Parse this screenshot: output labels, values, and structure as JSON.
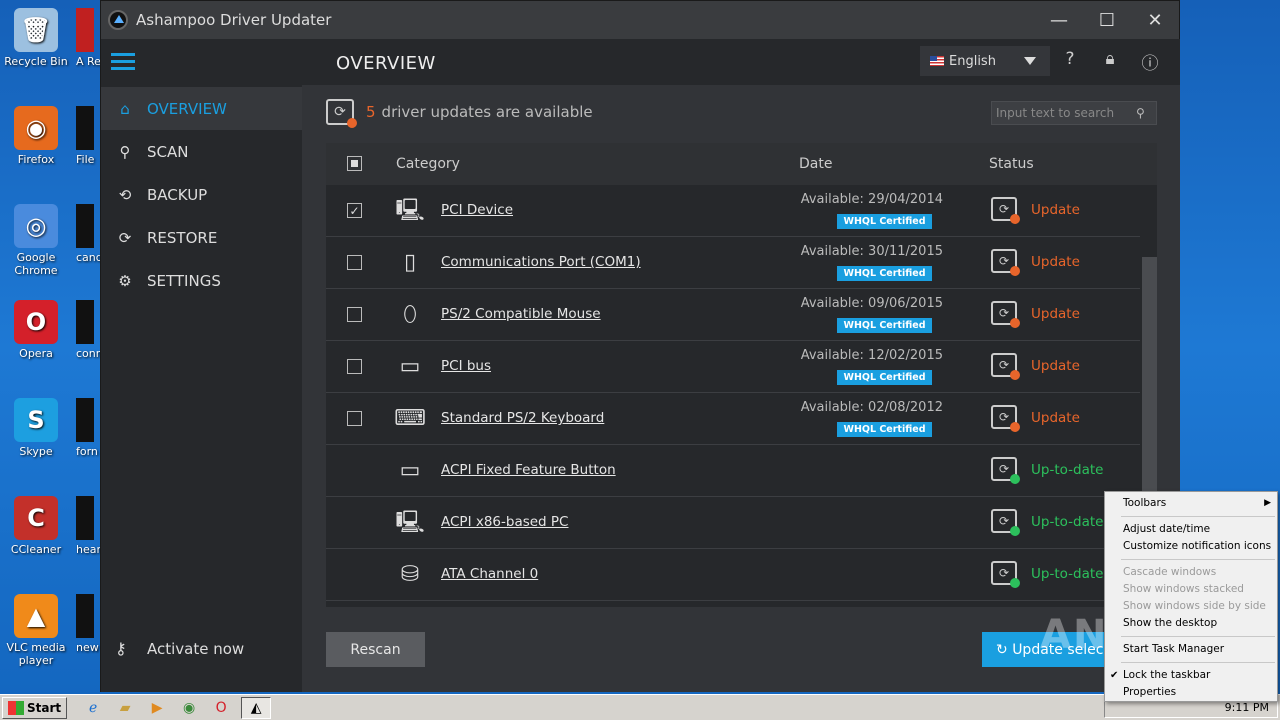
{
  "desktop": {
    "icons": [
      {
        "label": "Recycle Bin",
        "icon": "recycle-bin-icon",
        "color": "#9cc0e0"
      },
      {
        "label": "Firefox",
        "icon": "firefox-icon",
        "color": "#e66a1e"
      },
      {
        "label": "Google Chrome",
        "icon": "chrome-icon",
        "color": "#4a8bdd"
      },
      {
        "label": "Opera",
        "icon": "opera-icon",
        "color": "#d4202a"
      },
      {
        "label": "Skype",
        "icon": "skype-icon",
        "color": "#1d9fe0"
      },
      {
        "label": "CCleaner",
        "icon": "ccleaner-icon",
        "color": "#c3302a"
      },
      {
        "label": "VLC media player",
        "icon": "vlc-icon",
        "color": "#f08a1a"
      }
    ],
    "partial_icons": [
      "A Re",
      "File",
      "cand",
      "conn",
      "forn",
      "hear",
      "new"
    ]
  },
  "window": {
    "title": "Ashampoo Driver Updater",
    "page_title": "OVERVIEW",
    "language": "English",
    "nav": [
      {
        "label": "OVERVIEW",
        "icon": "home-icon",
        "active": true
      },
      {
        "label": "SCAN",
        "icon": "magnifier-icon",
        "active": false
      },
      {
        "label": "BACKUP",
        "icon": "backup-icon",
        "active": false
      },
      {
        "label": "RESTORE",
        "icon": "restore-icon",
        "active": false
      },
      {
        "label": "SETTINGS",
        "icon": "gear-icon",
        "active": false
      }
    ],
    "activate_label": "Activate now",
    "summary": {
      "count": "5",
      "text": "driver updates are available"
    },
    "search_placeholder": "Input text to search",
    "columns": {
      "category": "Category",
      "date": "Date",
      "status": "Status"
    },
    "rows": [
      {
        "name": "PCI Device",
        "icon": "pc-tower-icon",
        "glyph": "🖳",
        "checked": true,
        "has_checkbox": true,
        "date": "Available: 29/04/2014",
        "badge": "WHQL Certified",
        "status": "Update",
        "state": "update"
      },
      {
        "name": "Communications Port (COM1)",
        "icon": "usb-port-icon",
        "glyph": "▯",
        "checked": false,
        "has_checkbox": true,
        "date": "Available: 30/11/2015",
        "badge": "WHQL Certified",
        "status": "Update",
        "state": "update"
      },
      {
        "name": "PS/2 Compatible Mouse",
        "icon": "mouse-icon",
        "glyph": "⬯",
        "checked": false,
        "has_checkbox": true,
        "date": "Available: 09/06/2015",
        "badge": "WHQL Certified",
        "status": "Update",
        "state": "update"
      },
      {
        "name": "PCI bus",
        "icon": "monitor-icon",
        "glyph": "▭",
        "checked": false,
        "has_checkbox": true,
        "date": "Available: 12/02/2015",
        "badge": "WHQL Certified",
        "status": "Update",
        "state": "update"
      },
      {
        "name": "Standard PS/2 Keyboard",
        "icon": "keyboard-icon",
        "glyph": "⌨",
        "checked": false,
        "has_checkbox": true,
        "date": "Available: 02/08/2012",
        "badge": "WHQL Certified",
        "status": "Update",
        "state": "update"
      },
      {
        "name": "ACPI Fixed Feature Button",
        "icon": "monitor-icon",
        "glyph": "▭",
        "checked": false,
        "has_checkbox": false,
        "date": "",
        "badge": "",
        "status": "Up-to-date",
        "state": "ok"
      },
      {
        "name": "ACPI x86-based PC",
        "icon": "pc-tower-icon",
        "glyph": "🖳",
        "checked": false,
        "has_checkbox": false,
        "date": "",
        "badge": "",
        "status": "Up-to-date",
        "state": "ok"
      },
      {
        "name": "ATA Channel 0",
        "icon": "hard-drive-icon",
        "glyph": "⛁",
        "checked": false,
        "has_checkbox": false,
        "date": "",
        "badge": "",
        "status": "Up-to-date",
        "state": "ok"
      }
    ],
    "rescan_label": "Rescan",
    "update_selected_label": "Update selec",
    "colors": {
      "accent": "#1a9fe0",
      "update": "#e8652b",
      "ok": "#2cc05c"
    }
  },
  "context_menu": [
    {
      "label": "Toolbars",
      "disabled": false,
      "submenu": true,
      "checked": false
    },
    {
      "sep": true
    },
    {
      "label": "Adjust date/time",
      "disabled": false,
      "submenu": false,
      "checked": false
    },
    {
      "label": "Customize notification icons",
      "disabled": false,
      "submenu": false,
      "checked": false
    },
    {
      "sep": true
    },
    {
      "label": "Cascade windows",
      "disabled": true,
      "submenu": false,
      "checked": false
    },
    {
      "label": "Show windows stacked",
      "disabled": true,
      "submenu": false,
      "checked": false
    },
    {
      "label": "Show windows side by side",
      "disabled": true,
      "submenu": false,
      "checked": false
    },
    {
      "label": "Show the desktop",
      "disabled": false,
      "submenu": false,
      "checked": false
    },
    {
      "sep": true
    },
    {
      "label": "Start Task Manager",
      "disabled": false,
      "submenu": false,
      "checked": false
    },
    {
      "sep": true
    },
    {
      "label": "Lock the taskbar",
      "disabled": false,
      "submenu": false,
      "checked": true
    },
    {
      "label": "Properties",
      "disabled": false,
      "submenu": false,
      "checked": false
    }
  ],
  "taskbar": {
    "start_label": "Start",
    "clock": "9:11 PM"
  },
  "watermark": "ANY.RUN"
}
